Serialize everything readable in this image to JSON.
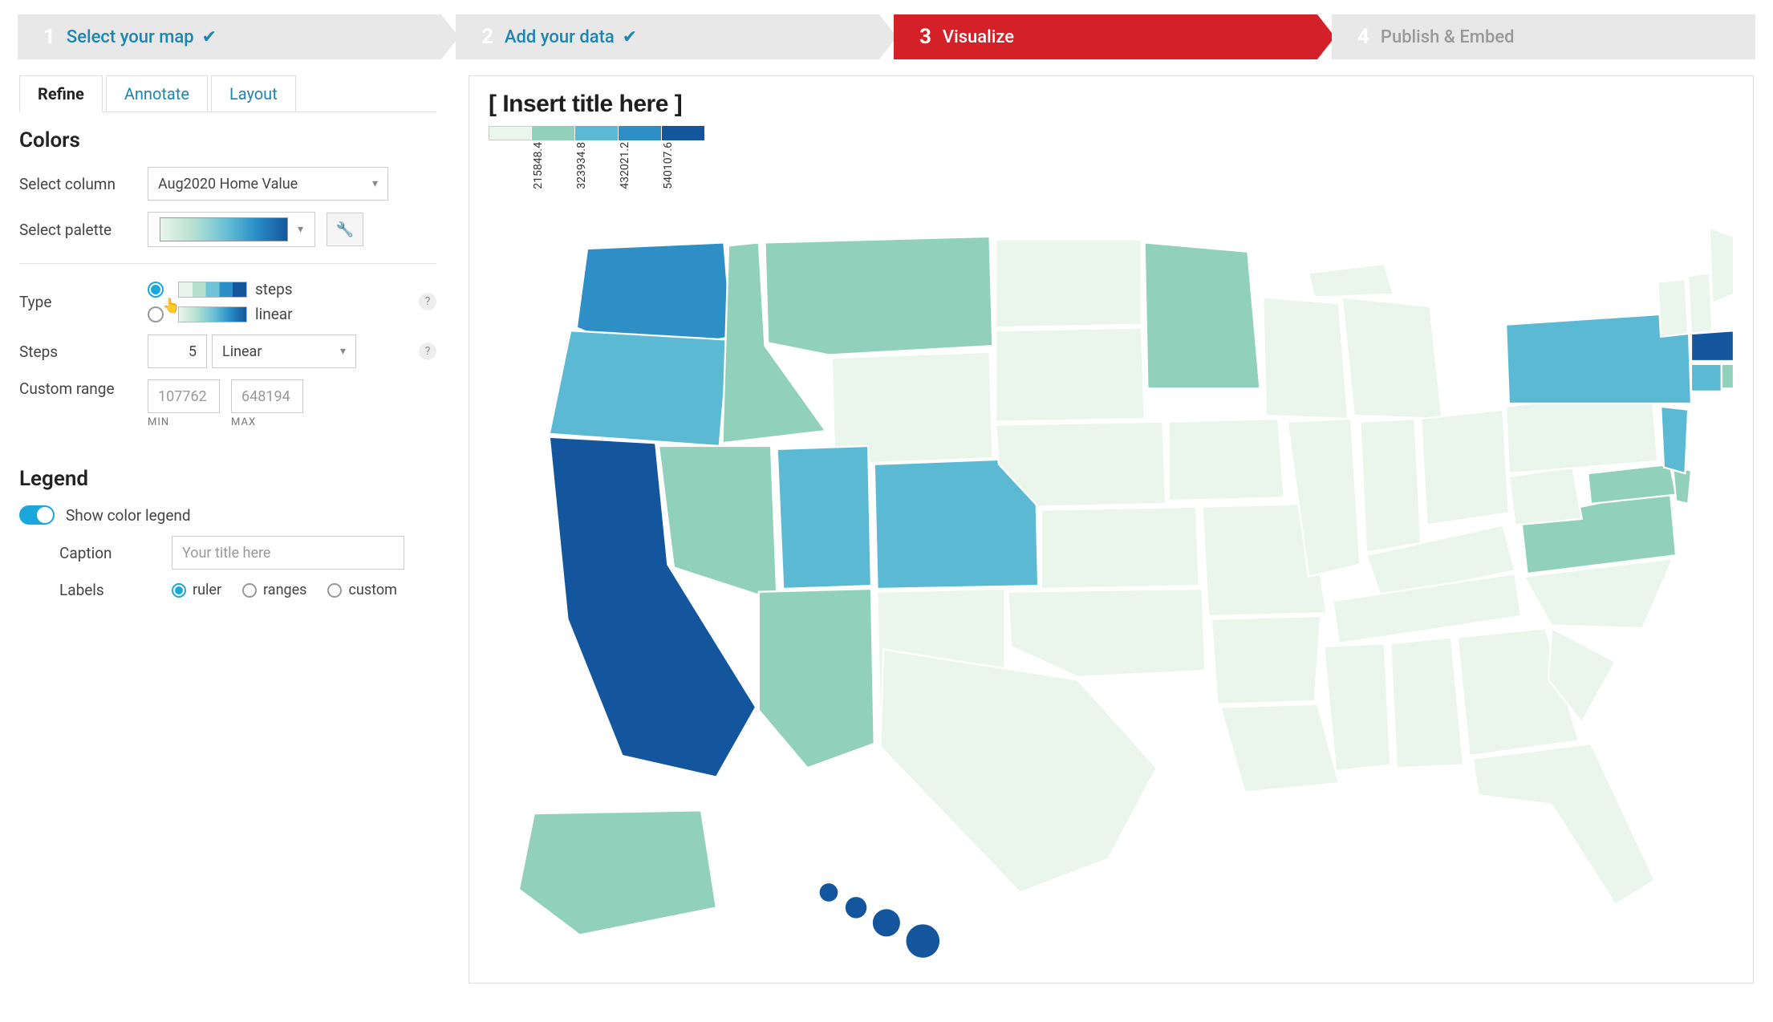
{
  "stepper": [
    {
      "num": "1",
      "label": "Select your map",
      "done": true,
      "active": false
    },
    {
      "num": "2",
      "label": "Add your data",
      "done": true,
      "active": false
    },
    {
      "num": "3",
      "label": "Visualize",
      "done": false,
      "active": true
    },
    {
      "num": "4",
      "label": "Publish & Embed",
      "done": false,
      "active": false,
      "future": true
    }
  ],
  "tabs": {
    "refine": "Refine",
    "annotate": "Annotate",
    "layout": "Layout",
    "active": "refine"
  },
  "colors": {
    "heading": "Colors",
    "select_column_label": "Select column",
    "select_column_value": "Aug2020 Home Value",
    "select_palette_label": "Select palette"
  },
  "type": {
    "label": "Type",
    "steps_label": "steps",
    "linear_label": "linear",
    "selected": "steps"
  },
  "steps": {
    "label": "Steps",
    "count": "5",
    "scale": "Linear"
  },
  "range": {
    "label": "Custom range",
    "min_placeholder": "107762",
    "max_placeholder": "648194",
    "min_label": "MIN",
    "max_label": "MAX"
  },
  "legend": {
    "heading": "Legend",
    "show_label": "Show color legend",
    "show": true,
    "caption_label": "Caption",
    "caption_placeholder": "Your title here",
    "labels_label": "Labels",
    "labels_options": {
      "ruler": "ruler",
      "ranges": "ranges",
      "custom": "custom"
    },
    "labels_selected": "ruler"
  },
  "preview": {
    "title": "[ Insert title here ]",
    "legend_ticks": [
      "215848.4",
      "323934.8",
      "432021.2",
      "540107.6"
    ],
    "palette": [
      "#eaf5eb",
      "#91d0bb",
      "#5cb9d3",
      "#2e8fc7",
      "#14569d"
    ]
  },
  "chart_data": {
    "type": "heatmap",
    "title": "[ Insert title here ]",
    "variable": "Aug2020 Home Value",
    "scale": "linear-steps",
    "steps": 5,
    "breaks": [
      215848.4,
      323934.8,
      432021.2,
      540107.6
    ],
    "palette": [
      "#eaf5eb",
      "#91d0bb",
      "#5cb9d3",
      "#2e8fc7",
      "#14569d"
    ],
    "xlabel": "",
    "ylabel": "",
    "states_by_bin": {
      "1": [
        "ME",
        "VT",
        "NH",
        "PA",
        "OH",
        "WV",
        "KY",
        "IN",
        "MI",
        "WI",
        "IL",
        "IA",
        "MO",
        "AR",
        "LA",
        "MS",
        "AL",
        "TN",
        "OK",
        "KS",
        "NE",
        "SD",
        "ND",
        "WY",
        "NM",
        "TX",
        "SC",
        "NC",
        "GA",
        "FL"
      ],
      "2": [
        "MN",
        "MT",
        "ID",
        "NV",
        "AZ",
        "VA",
        "DE",
        "MD",
        "RI",
        "AK"
      ],
      "3": [
        "OR",
        "CO",
        "UT",
        "NY",
        "CT",
        "NJ"
      ],
      "4": [
        "WA"
      ],
      "5": [
        "CA",
        "MA",
        "HI"
      ]
    }
  }
}
